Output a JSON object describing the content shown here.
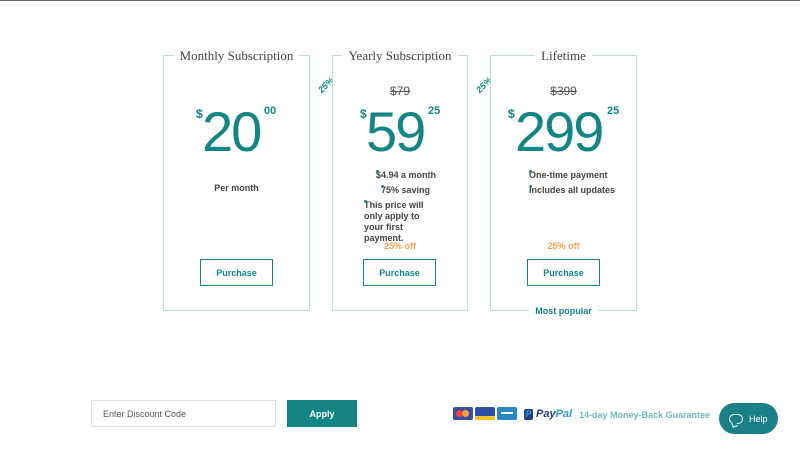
{
  "plans": [
    {
      "title": "Monthly Subscription",
      "currency": "$",
      "amount": "20",
      "cents": "00",
      "subtitle": "Per month",
      "button": "Purchase"
    },
    {
      "title": "Yearly Subscription",
      "ribbon": "25%",
      "old_price": "$79",
      "currency": "$",
      "amount": "59",
      "cents": "25",
      "features": [
        "$4.94 a month",
        "75% saving",
        "This price will only apply to your first payment."
      ],
      "discount": "25% off",
      "button": "Purchase"
    },
    {
      "title": "Lifetime",
      "ribbon": "25%",
      "old_price": "$399",
      "currency": "$",
      "amount": "299",
      "cents": "25",
      "features": [
        "One-time payment",
        "Includes all updates"
      ],
      "discount": "25% off",
      "button": "Purchase",
      "badge": "Most popular"
    }
  ],
  "discount": {
    "placeholder": "Enter Discount Code",
    "apply_label": "Apply"
  },
  "payment": {
    "icons": [
      "mastercard-icon",
      "visa-icon",
      "amex-icon"
    ],
    "paypal_prefix": "Pay",
    "paypal_suffix": "Pal",
    "guarantee": "14-day Money-Back Guarantee"
  },
  "help": {
    "label": "Help"
  },
  "colors": {
    "accent": "#138585",
    "discount": "#f0a24a",
    "border": "#b9dede"
  }
}
